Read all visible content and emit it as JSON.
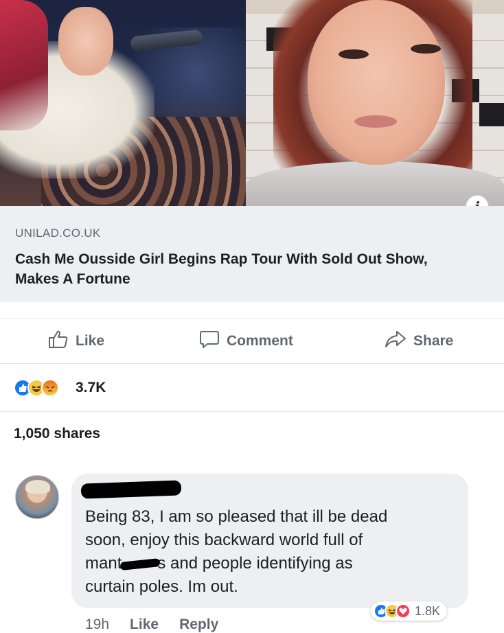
{
  "link": {
    "source": "UNILAD.CO.UK",
    "title": "Cash Me Ousside Girl Begins Rap Tour With Sold Out Show, Makes A Fortune",
    "info_icon": "info-icon"
  },
  "actions": {
    "like_label": "Like",
    "comment_label": "Comment",
    "share_label": "Share"
  },
  "reactions": {
    "icons": [
      "like-icon",
      "haha-icon",
      "angry-icon"
    ],
    "count": "3.7K"
  },
  "shares": {
    "label": "1,050 shares"
  },
  "comment": {
    "text_line1": "Being 83, I am so pleased that ill be dead",
    "text_line2": "soon, enjoy this backward world full of",
    "text_line3_start": "mant",
    "text_line3_end": "s and people identifying as",
    "text_line4": "curtain poles. Im out.",
    "time": "19h",
    "like_label": "Like",
    "reply_label": "Reply",
    "reaction_icons": [
      "like-icon",
      "haha-icon",
      "love-icon"
    ],
    "reaction_count": "1.8K"
  },
  "colors": {
    "facebook_blue": "#1877f2",
    "text_primary": "#1c1e21",
    "text_secondary": "#606770",
    "card_background": "#edeff2"
  }
}
